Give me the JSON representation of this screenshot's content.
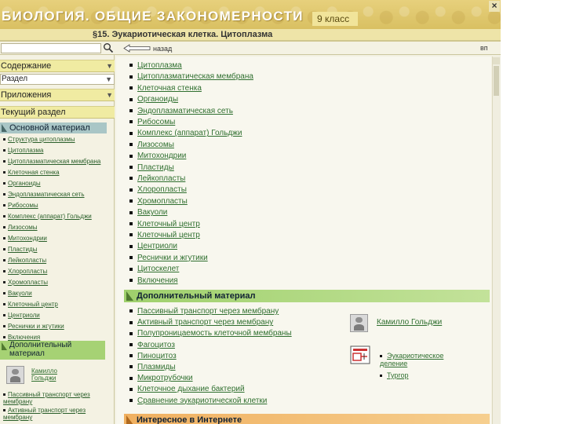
{
  "header": {
    "title": "БИОЛОГИЯ. ОБЩИЕ ЗАКОНОМЕРНОСТИ",
    "grade": "9 класс",
    "close_glyph": "×"
  },
  "page": {
    "title": "§15. Эукариотическая клетка. Цитоплазма"
  },
  "toolbar": {
    "search_value": "",
    "back_label": "назад",
    "next_label": "вп"
  },
  "sidebar": {
    "contents_label": "Содержание",
    "section_label": "Раздел",
    "appendix_label": "Приложения",
    "current_label": "Текущий раздел",
    "main_head": "Основной материал",
    "main_items": [
      "Структура цитоплазмы",
      "Цитоплазма",
      "Цитоплазматическая мембрана",
      "Клеточная стенка",
      "Органоиды",
      "Эндоплазматическая сеть",
      "Рибосомы",
      "Комплекс (аппарат) Гольджи",
      "Лизосомы",
      "Митохондрии",
      "Пластиды",
      "Лейкопласты",
      "Хлоропласты",
      "Хромопласты",
      "Вакуоли",
      "Клеточный центр",
      "Центриоли",
      "Реснички и жгутики",
      "Включения"
    ],
    "extra_head": "Дополнительный материал",
    "bio_link": "Камилло Гольджи",
    "extra_items": [
      "Пассивный транспорт через мембрану",
      "Активный транспорт через мембрану"
    ]
  },
  "main": {
    "topics": [
      "Цитоплазма",
      "Цитоплазматическая мембрана",
      "Клеточная стенка",
      "Органоиды",
      "Эндоплазматическая сеть",
      "Рибосомы",
      "Комплекс (аппарат) Гольджи",
      "Лизосомы",
      "Митохондрии",
      "Пластиды",
      "Лейкопласты",
      "Хлоропласты",
      "Хромопласты",
      "Вакуоли",
      "Клеточный центр",
      "Клеточный центр",
      "Центриоли",
      "Реснички и жгутики",
      "Цитоскелет",
      "Включения"
    ],
    "extra_head": "Дополнительный материал",
    "extra_items": [
      "Пассивный транспорт через мембрану",
      "Активный транспорт через мембрану",
      "Полупроницаемость клеточной мембраны",
      "Фагоцитоз",
      "Пиноцитоз",
      "Плазмиды",
      "Микротрубочки",
      "Клеточное дыхание бактерий",
      "Сравнение эукариотической клетки"
    ],
    "bio_link": "Камилло Гольджи",
    "multimedia_items": [
      "Эукариотическое деление",
      "Тургор"
    ],
    "internet_head": "Интересное в Интернете"
  }
}
